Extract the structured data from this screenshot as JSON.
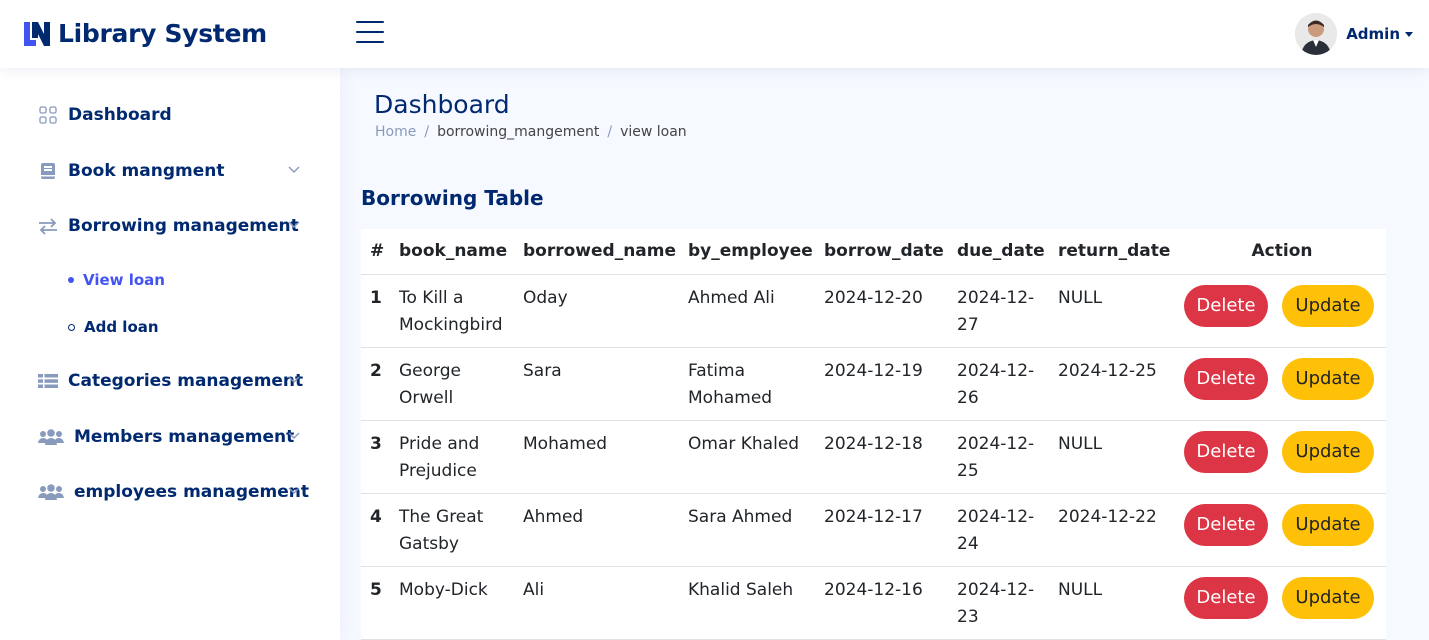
{
  "app": {
    "title": "Library System"
  },
  "header": {
    "profile_name": "Admin"
  },
  "sidebar": {
    "items": [
      {
        "label": "Dashboard",
        "icon": "grid-icon"
      },
      {
        "label": "Book mangment",
        "icon": "book-icon"
      },
      {
        "label": "Borrowing management",
        "icon": "arrows-exchange-icon"
      },
      {
        "label": "Categories management",
        "icon": "list-icon"
      },
      {
        "label": "Members management",
        "icon": "people-icon"
      },
      {
        "label": "employees management",
        "icon": "people-icon"
      }
    ],
    "sub_items": [
      {
        "label": "View loan",
        "active": true
      },
      {
        "label": "Add loan",
        "active": false
      }
    ]
  },
  "page": {
    "title": "Dashboard",
    "breadcrumb": [
      "Home",
      "borrowing_mangement",
      "view loan"
    ],
    "card_title": "Borrowing Table"
  },
  "table": {
    "headers": [
      "#",
      "book_name",
      "borrowed_name",
      "by_employee",
      "borrow_date",
      "due_date",
      "return_date",
      "Action"
    ],
    "rows": [
      {
        "num": "1",
        "book": [
          "To Kill a",
          "Mockingbird"
        ],
        "borrowed": "Oday",
        "emp": [
          "Ahmed Ali"
        ],
        "bdate": "2024-12-20",
        "due": [
          "2024-12-",
          "27"
        ],
        "ret": "NULL"
      },
      {
        "num": "2",
        "book": [
          "George",
          "Orwell"
        ],
        "borrowed": "Sara",
        "emp": [
          "Fatima",
          "Mohamed"
        ],
        "bdate": "2024-12-19",
        "due": [
          "2024-12-",
          "26"
        ],
        "ret": "2024-12-25"
      },
      {
        "num": "3",
        "book": [
          "Pride and",
          "Prejudice"
        ],
        "borrowed": "Mohamed",
        "emp": [
          "Omar Khaled"
        ],
        "bdate": "2024-12-18",
        "due": [
          "2024-12-",
          "25"
        ],
        "ret": "NULL"
      },
      {
        "num": "4",
        "book": [
          "The Great",
          "Gatsby"
        ],
        "borrowed": "Ahmed",
        "emp": [
          "Sara Ahmed"
        ],
        "bdate": "2024-12-17",
        "due": [
          "2024-12-",
          "24"
        ],
        "ret": "2024-12-22"
      },
      {
        "num": "5",
        "book": [
          "Moby-Dick"
        ],
        "borrowed": "Ali",
        "emp": [
          "Khalid Saleh"
        ],
        "bdate": "2024-12-16",
        "due": [
          "2024-12-",
          "23"
        ],
        "ret": "NULL"
      }
    ],
    "delete_label": "Delete",
    "update_label": "Update"
  },
  "colors": {
    "brand": "#012970",
    "link_active": "#4154f1",
    "danger": "#dc3545",
    "warning": "#ffc107",
    "muted": "#899bbd"
  }
}
